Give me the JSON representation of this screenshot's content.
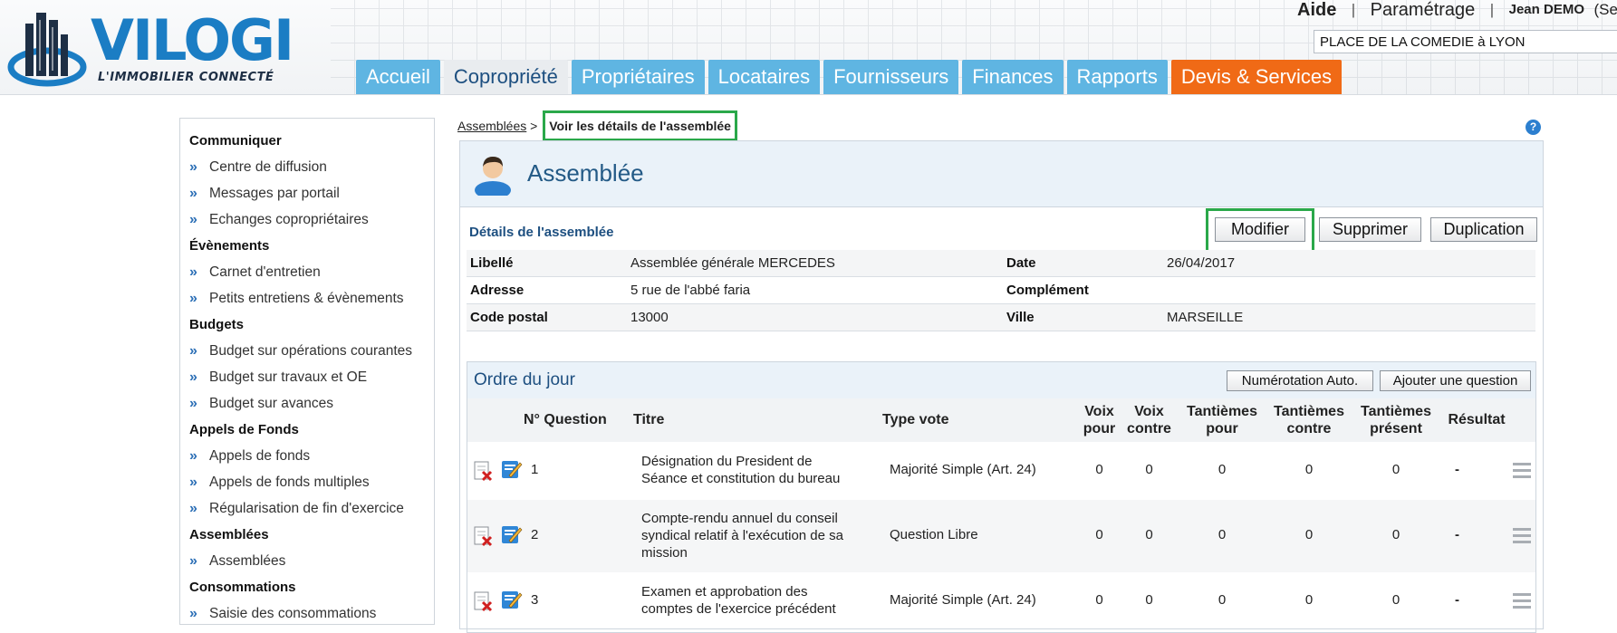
{
  "header": {
    "logo_text": "VILOGI",
    "logo_tagline": "L'IMMOBILIER CONNECTÉ",
    "links": {
      "help": "Aide",
      "settings": "Paramétrage",
      "separator": "|",
      "user": "Jean DEMO",
      "user_suffix": "(Se"
    },
    "site_select_value": "PLACE DE LA COMEDIE à LYON",
    "nav_tabs": [
      "Accueil",
      "Copropriété",
      "Propriétaires",
      "Locataires",
      "Fournisseurs",
      "Finances",
      "Rapports",
      "Devis & Services"
    ],
    "active_tab": "Copropriété"
  },
  "sidebar": {
    "sections": [
      {
        "title": "Communiquer",
        "items": [
          "Centre de diffusion",
          "Messages par portail",
          "Echanges copropriétaires"
        ]
      },
      {
        "title": "Évènements",
        "items": [
          "Carnet d'entretien",
          "Petits entretiens & évènements"
        ]
      },
      {
        "title": "Budgets",
        "items": [
          "Budget sur opérations courantes",
          "Budget sur travaux et OE",
          "Budget sur avances"
        ]
      },
      {
        "title": "Appels de Fonds",
        "items": [
          "Appels de fonds",
          "Appels de fonds multiples",
          "Régularisation de fin d'exercice"
        ]
      },
      {
        "title": "Assemblées",
        "items": [
          "Assemblées"
        ]
      },
      {
        "title": "Consommations",
        "items": [
          "Saisie des consommations"
        ]
      }
    ],
    "chevron": "»"
  },
  "breadcrumb": {
    "parent": "Assemblées",
    "separator": ">",
    "current": "Voir les détails de l'assemblée"
  },
  "help_icon_glyph": "?",
  "panel": {
    "title": "Assemblée",
    "details_title": "Détails de l'assemblée",
    "buttons": {
      "edit": "Modifier",
      "delete": "Supprimer",
      "duplicate": "Duplication"
    },
    "details": [
      {
        "label1": "Libellé",
        "value1": "Assemblée générale MERCEDES",
        "label2": "Date",
        "value2": "26/04/2017"
      },
      {
        "label1": "Adresse",
        "value1": "5 rue de l'abbé faria",
        "label2": "Complément",
        "value2": ""
      },
      {
        "label1": "Code postal",
        "value1": "13000",
        "label2": "Ville",
        "value2": "MARSEILLE"
      }
    ]
  },
  "agenda": {
    "title": "Ordre du jour",
    "buttons": {
      "auto_number": "Numérotation Auto.",
      "add_question": "Ajouter une question"
    },
    "columns": {
      "num": "N° Question",
      "title": "Titre",
      "vote_type": "Type vote",
      "votes_for_1": "Voix",
      "votes_for_2": "pour",
      "votes_against_1": "Voix",
      "votes_against_2": "contre",
      "shares_for_1": "Tantièmes",
      "shares_for_2": "pour",
      "shares_against_1": "Tantièmes",
      "shares_against_2": "contre",
      "shares_present_1": "Tantièmes",
      "shares_present_2": "présent",
      "result": "Résultat"
    },
    "rows": [
      {
        "num": "1",
        "title_l1": "Désignation du President de",
        "title_l2": "Séance et constitution du bureau",
        "title_l3": "",
        "vote_type": "Majorité Simple (Art. 24)",
        "votes_for": "0",
        "votes_against": "0",
        "shares_for": "0",
        "shares_against": "0",
        "shares_present": "0",
        "result": "-"
      },
      {
        "num": "2",
        "title_l1": "Compte-rendu annuel du conseil",
        "title_l2": "syndical relatif à l'exécution de sa",
        "title_l3": "mission",
        "vote_type": "Question Libre",
        "votes_for": "0",
        "votes_against": "0",
        "shares_for": "0",
        "shares_against": "0",
        "shares_present": "0",
        "result": "-"
      },
      {
        "num": "3",
        "title_l1": "Examen et approbation des",
        "title_l2": "comptes de l'exercice précédent",
        "title_l3": "",
        "vote_type": "Majorité Simple (Art. 24)",
        "votes_for": "0",
        "votes_against": "0",
        "shares_for": "0",
        "shares_against": "0",
        "shares_present": "0",
        "result": "-"
      }
    ]
  }
}
